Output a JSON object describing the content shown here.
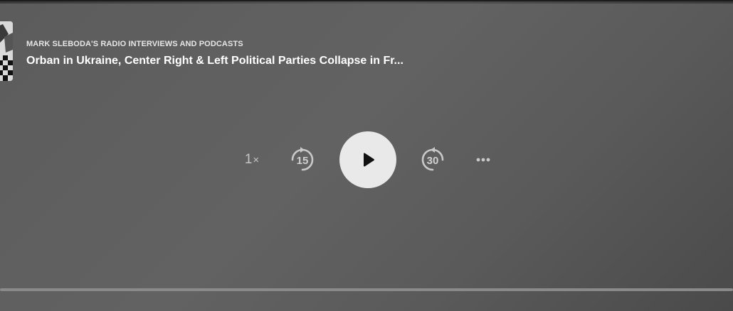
{
  "episode": {
    "podcast_name": "MARK SLEBODA'S RADIO INTERVIEWS AND PODCASTS",
    "title": "Orban in Ukraine, Center Right & Left Political Parties Collapse in Fr..."
  },
  "controls": {
    "speed_value": "1",
    "speed_suffix": "×",
    "skip_back_seconds": "15",
    "skip_forward_seconds": "30",
    "play_icon": "play-icon",
    "more_icon": "more-icon"
  },
  "progress": {
    "fraction": 0.0
  },
  "colors": {
    "background": "#5e5e5e",
    "play_button": "#e9e9e9",
    "control_icons": "#c9c9c9",
    "progress_track": "#8a8a8a"
  }
}
